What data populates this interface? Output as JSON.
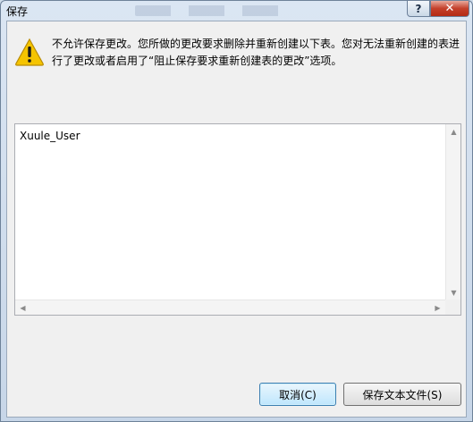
{
  "window": {
    "title": "保存"
  },
  "titlebar": {
    "help_glyph": "?",
    "close_glyph": "✕"
  },
  "dialog": {
    "message": "不允许保存更改。您所做的更改要求删除并重新创建以下表。您对无法重新创建的表进行了更改或者启用了“阻止保存要求重新创建表的更改”选项。",
    "list_items": [
      "Xuule_User"
    ],
    "buttons": {
      "cancel": "取消(C)",
      "save_text_file": "保存文本文件(S)"
    }
  },
  "colors": {
    "warning_fill": "#f5c400",
    "close_button": "#c4402b",
    "default_button_border": "#3c7fb1"
  }
}
